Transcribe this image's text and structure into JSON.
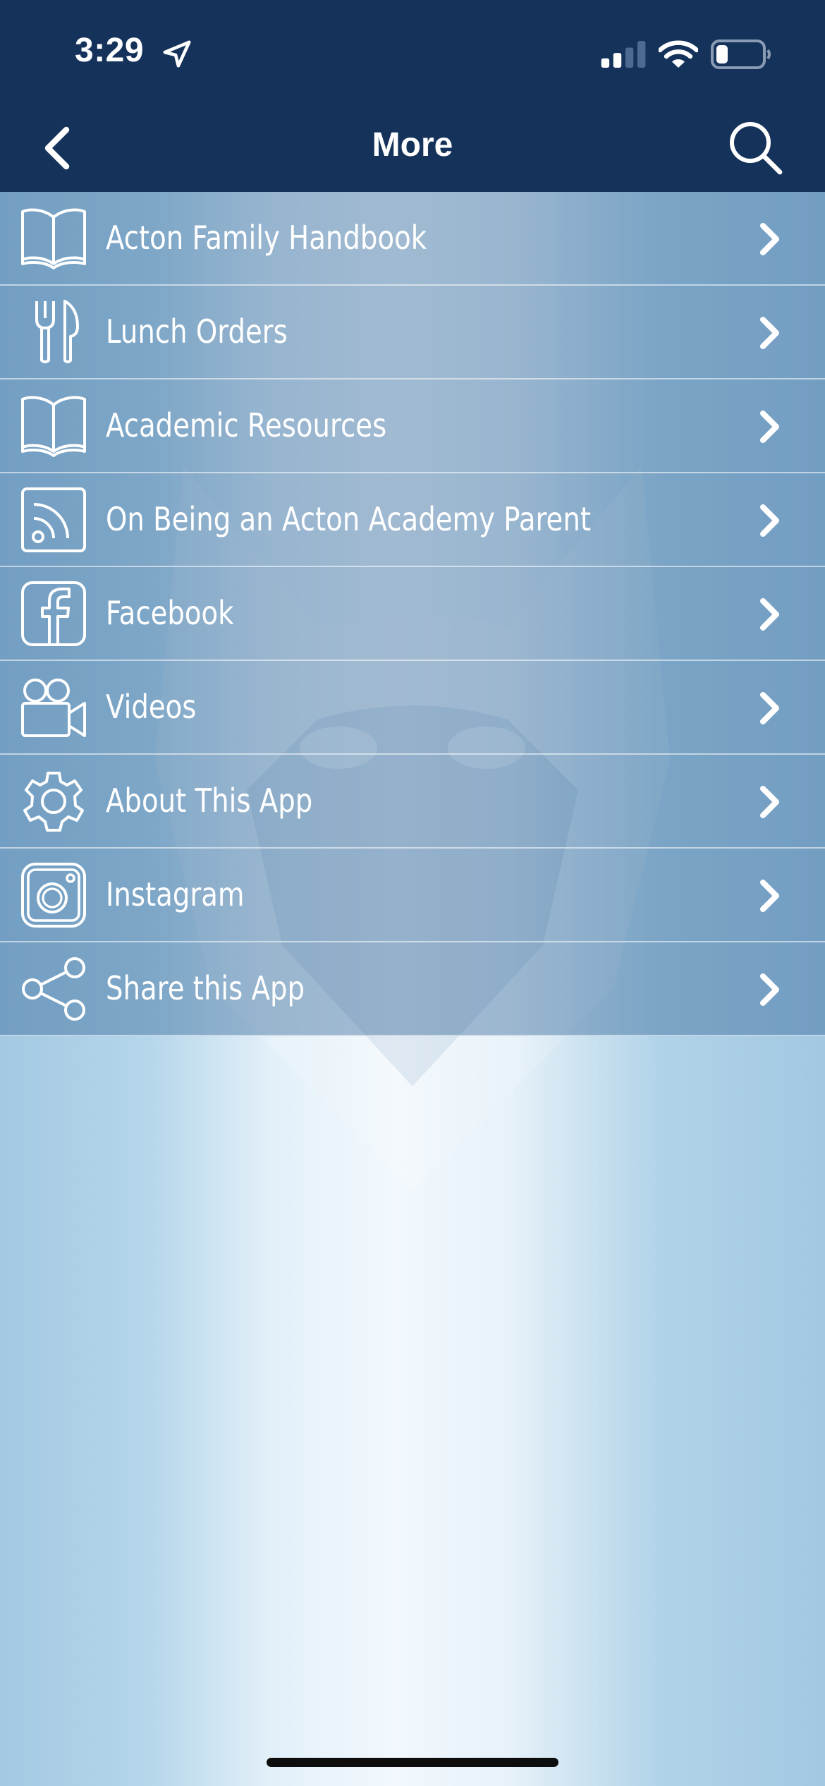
{
  "status_bar": {
    "time": "3:29",
    "location_icon": "location-arrow-icon",
    "signal_icon": "cellular-signal-icon",
    "wifi_icon": "wifi-icon",
    "battery_icon": "battery-icon"
  },
  "nav": {
    "title": "More",
    "back_icon": "chevron-left-icon",
    "search_icon": "search-icon"
  },
  "menu": {
    "items": [
      {
        "label": "Acton Family Handbook",
        "icon": "open-book-icon"
      },
      {
        "label": "Lunch Orders",
        "icon": "fork-knife-icon"
      },
      {
        "label": "Academic Resources",
        "icon": "open-book-icon"
      },
      {
        "label": "On Being an Acton Academy Parent",
        "icon": "rss-feed-icon"
      },
      {
        "label": "Facebook",
        "icon": "facebook-icon"
      },
      {
        "label": "Videos",
        "icon": "video-camera-icon"
      },
      {
        "label": "About This App",
        "icon": "gear-icon"
      },
      {
        "label": "Instagram",
        "icon": "instagram-icon"
      },
      {
        "label": "Share this App",
        "icon": "share-icon"
      }
    ]
  },
  "colors": {
    "header_background": "#14325a",
    "page_gradient_edge": "#a4c9e3",
    "page_gradient_center": "#f2f8fd",
    "text": "#ffffff"
  }
}
